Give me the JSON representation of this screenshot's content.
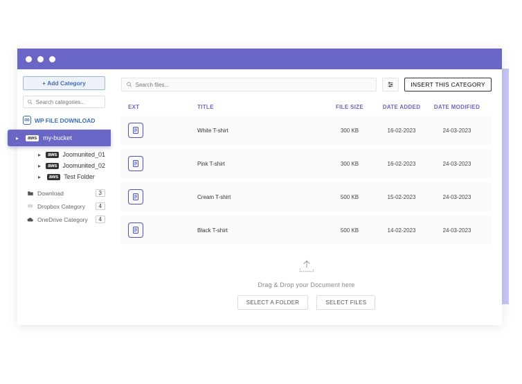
{
  "sidebar": {
    "add_category": "Add Category",
    "search_placeholder": "Search categories...",
    "root_label": "WP FILE DOWNLOAD",
    "selected": {
      "provider": "aws",
      "label": "my-bucket"
    },
    "children": [
      {
        "provider": "aws",
        "label": "Joomunited_01"
      },
      {
        "provider": "aws",
        "label": "Joomunited_02"
      },
      {
        "provider": "aws",
        "label": "Test Folder"
      }
    ],
    "other_categories": [
      {
        "icon": "folder",
        "label": "Download",
        "count": "3"
      },
      {
        "icon": "dropbox",
        "label": "Dropbox Category",
        "count": "4"
      },
      {
        "icon": "cloud",
        "label": "OneDrive Category",
        "count": "4"
      }
    ]
  },
  "main": {
    "search_placeholder": "Search files...",
    "insert_button": "INSERT THIS CATEGORY",
    "columns": {
      "ext": "EXT",
      "title": "TITLE",
      "size": "FILE SIZE",
      "added": "DATE ADDED",
      "modified": "DATE MODIFIED"
    },
    "rows": [
      {
        "title": "White T-shirt",
        "size": "300 KB",
        "added": "16-02-2023",
        "modified": "24-03-2023"
      },
      {
        "title": "Pink T-shirt",
        "size": "300 KB",
        "added": "16-02-2023",
        "modified": "24-03-2023"
      },
      {
        "title": "Cream T-shirt",
        "size": "500 KB",
        "added": "15-02-2023",
        "modified": "24-03-2023"
      },
      {
        "title": "Black T-shirt",
        "size": "500 KB",
        "added": "14-02-2023",
        "modified": "24-03-2023"
      }
    ],
    "dropzone": {
      "text": "Drag & Drop your Document here",
      "select_folder": "SELECT A FOLDER",
      "select_files": "SELECT FILES"
    }
  }
}
